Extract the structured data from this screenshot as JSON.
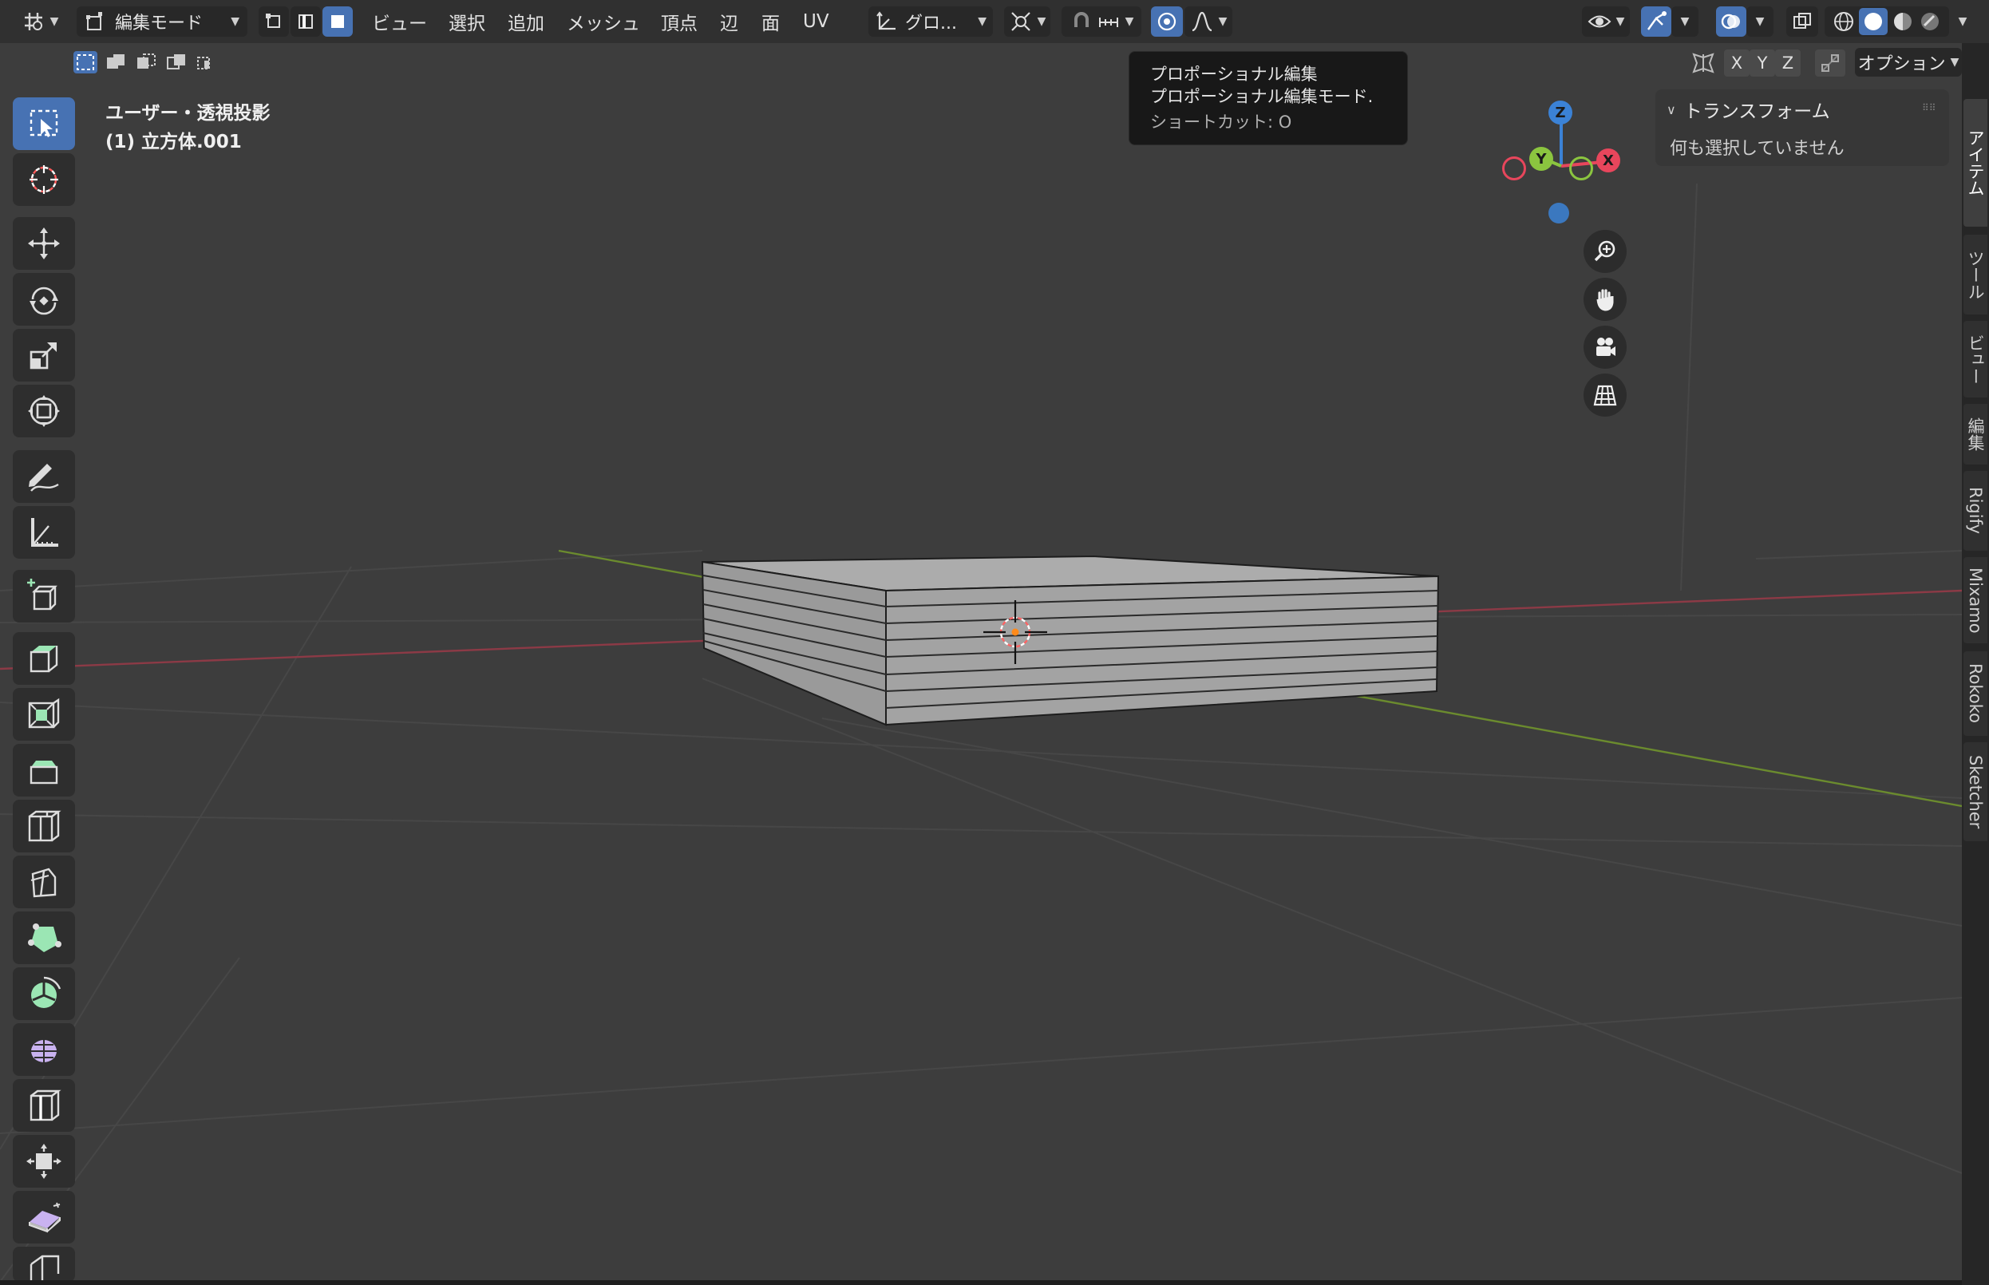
{
  "header": {
    "mode_label": "編集モード",
    "menus": [
      "ビュー",
      "選択",
      "追加",
      "メッシュ",
      "頂点",
      "辺",
      "面",
      "UV"
    ],
    "transform_orientation": "グロ...",
    "options_label": "オプション",
    "mirror_axes": [
      "X",
      "Y",
      "Z"
    ]
  },
  "viewport": {
    "view_name": "ユーザー・透視投影",
    "object_name": "(1) 立方体.001"
  },
  "tooltip": {
    "title": "プロポーショナル編集",
    "description": "プロポーショナル編集モード.",
    "shortcut": "ショートカット: O"
  },
  "npanel": {
    "section_title": "トランスフォーム",
    "empty_message": "何も選択していません"
  },
  "sidebar_tabs": [
    "アイテム",
    "ツール",
    "ビュー",
    "編集",
    "Rigify",
    "Mixamo",
    "Rokoko",
    "Sketcher"
  ],
  "gizmo": {
    "x": "X",
    "y": "Y",
    "z": "Z"
  },
  "colors": {
    "accent": "#4772b3",
    "axis_x": "#e8465c",
    "axis_y": "#8bc53f",
    "axis_z": "#3b82d6",
    "tool_add": "#9be6b4",
    "tool_purple": "#c9b2f0"
  }
}
